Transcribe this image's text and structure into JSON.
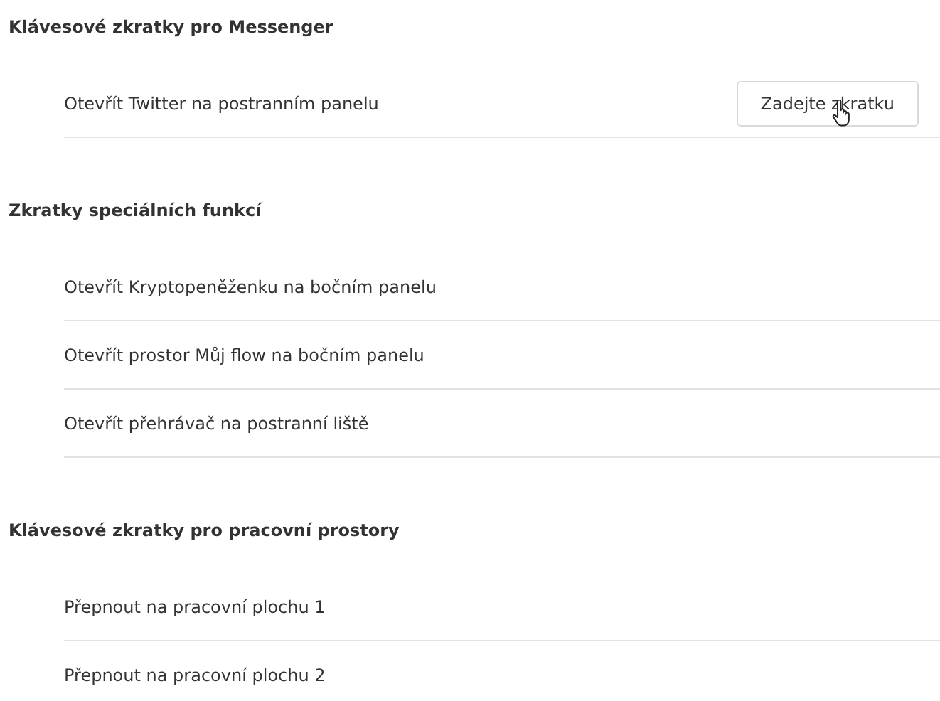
{
  "sections": [
    {
      "title": "Klávesové zkratky pro Messenger",
      "rows": [
        {
          "label": "Otevřít Twitter na postranním panelu",
          "button": "Zadejte zkratku"
        }
      ]
    },
    {
      "title": "Zkratky speciálních funkcí",
      "rows": [
        {
          "label": "Otevřít Kryptopeněženku na bočním panelu"
        },
        {
          "label": "Otevřít prostor Můj flow na bočním panelu"
        },
        {
          "label": "Otevřít přehrávač na postranní liště"
        }
      ]
    },
    {
      "title": "Klávesové zkratky pro pracovní prostory",
      "rows": [
        {
          "label": "Přepnout na pracovní plochu 1"
        },
        {
          "label": "Přepnout na pracovní plochu 2"
        }
      ]
    }
  ]
}
